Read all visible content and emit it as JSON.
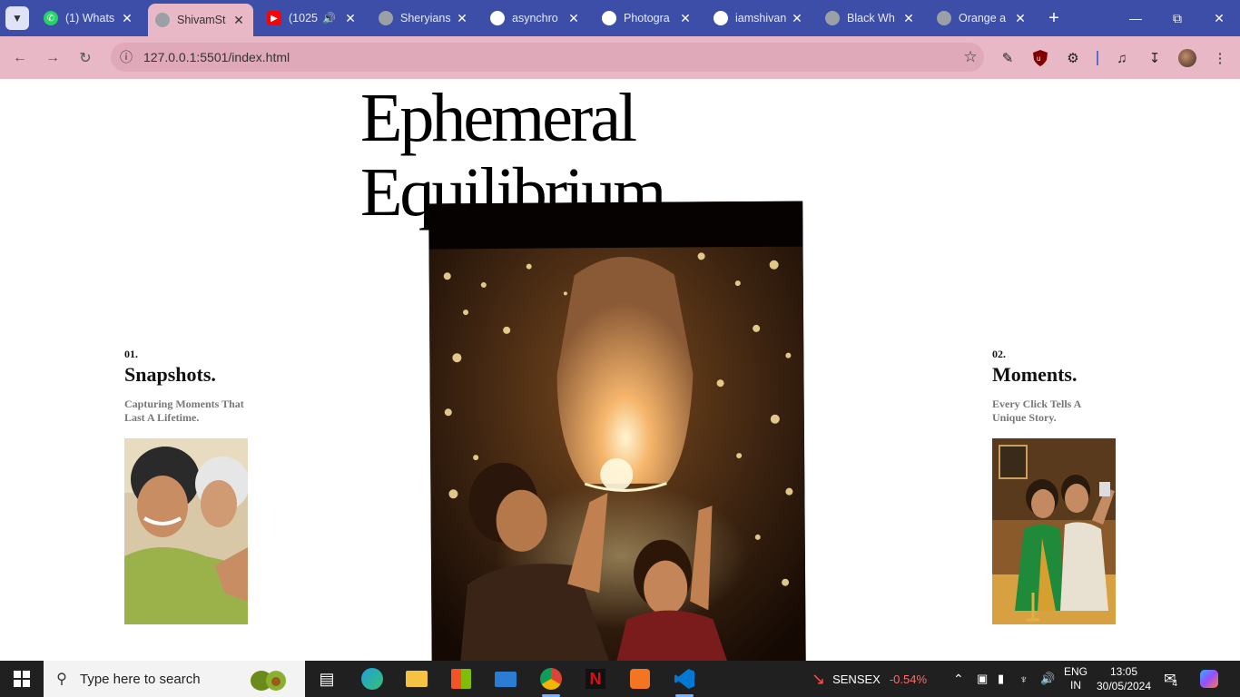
{
  "browser": {
    "tabs": [
      {
        "title": "(1) Whats",
        "favicon": "whatsapp-icon",
        "color": "#25d366"
      },
      {
        "title": "ShivamSt",
        "favicon": "globe-icon",
        "color": "#9aa0a6",
        "active": true
      },
      {
        "title": "(1025",
        "favicon": "youtube-icon",
        "color": "#ff0000",
        "audio": true
      },
      {
        "title": "Sheryians",
        "favicon": "globe-icon",
        "color": "#9aa0a6"
      },
      {
        "title": "asynchro",
        "favicon": "github-icon",
        "color": "#ffffff"
      },
      {
        "title": "Photogra",
        "favicon": "github-icon",
        "color": "#ffffff"
      },
      {
        "title": "iamshivan",
        "favicon": "github-icon",
        "color": "#ffffff"
      },
      {
        "title": "Black Wh",
        "favicon": "globe-icon",
        "color": "#9aa0a6"
      },
      {
        "title": "Orange a",
        "favicon": "globe-icon",
        "color": "#9aa0a6"
      }
    ],
    "url": "127.0.0.1:5501/index.html"
  },
  "page": {
    "title_line1": "Ephemeral",
    "title_line2": "Equilibrium",
    "left_card": {
      "number": "01.",
      "heading": "Snapshots.",
      "desc_line1": "Capturing Moments That",
      "desc_line2": "Last A Lifetime."
    },
    "right_card": {
      "number": "02.",
      "heading": "Moments.",
      "desc_line1": "Every Click Tells A",
      "desc_line2": "Unique Story."
    }
  },
  "taskbar": {
    "search_placeholder": "Type here to search",
    "stock_name": "SENSEX",
    "stock_change": "-0.54%",
    "lang_line1": "ENG",
    "lang_line2": "IN",
    "time": "13:05",
    "date": "30/05/2024",
    "notification_count": "4"
  },
  "colors": {
    "tabstrip": "#3d4ea8",
    "toolbar": "#e9b8c6",
    "stock_negative": "#ff6b6b"
  }
}
